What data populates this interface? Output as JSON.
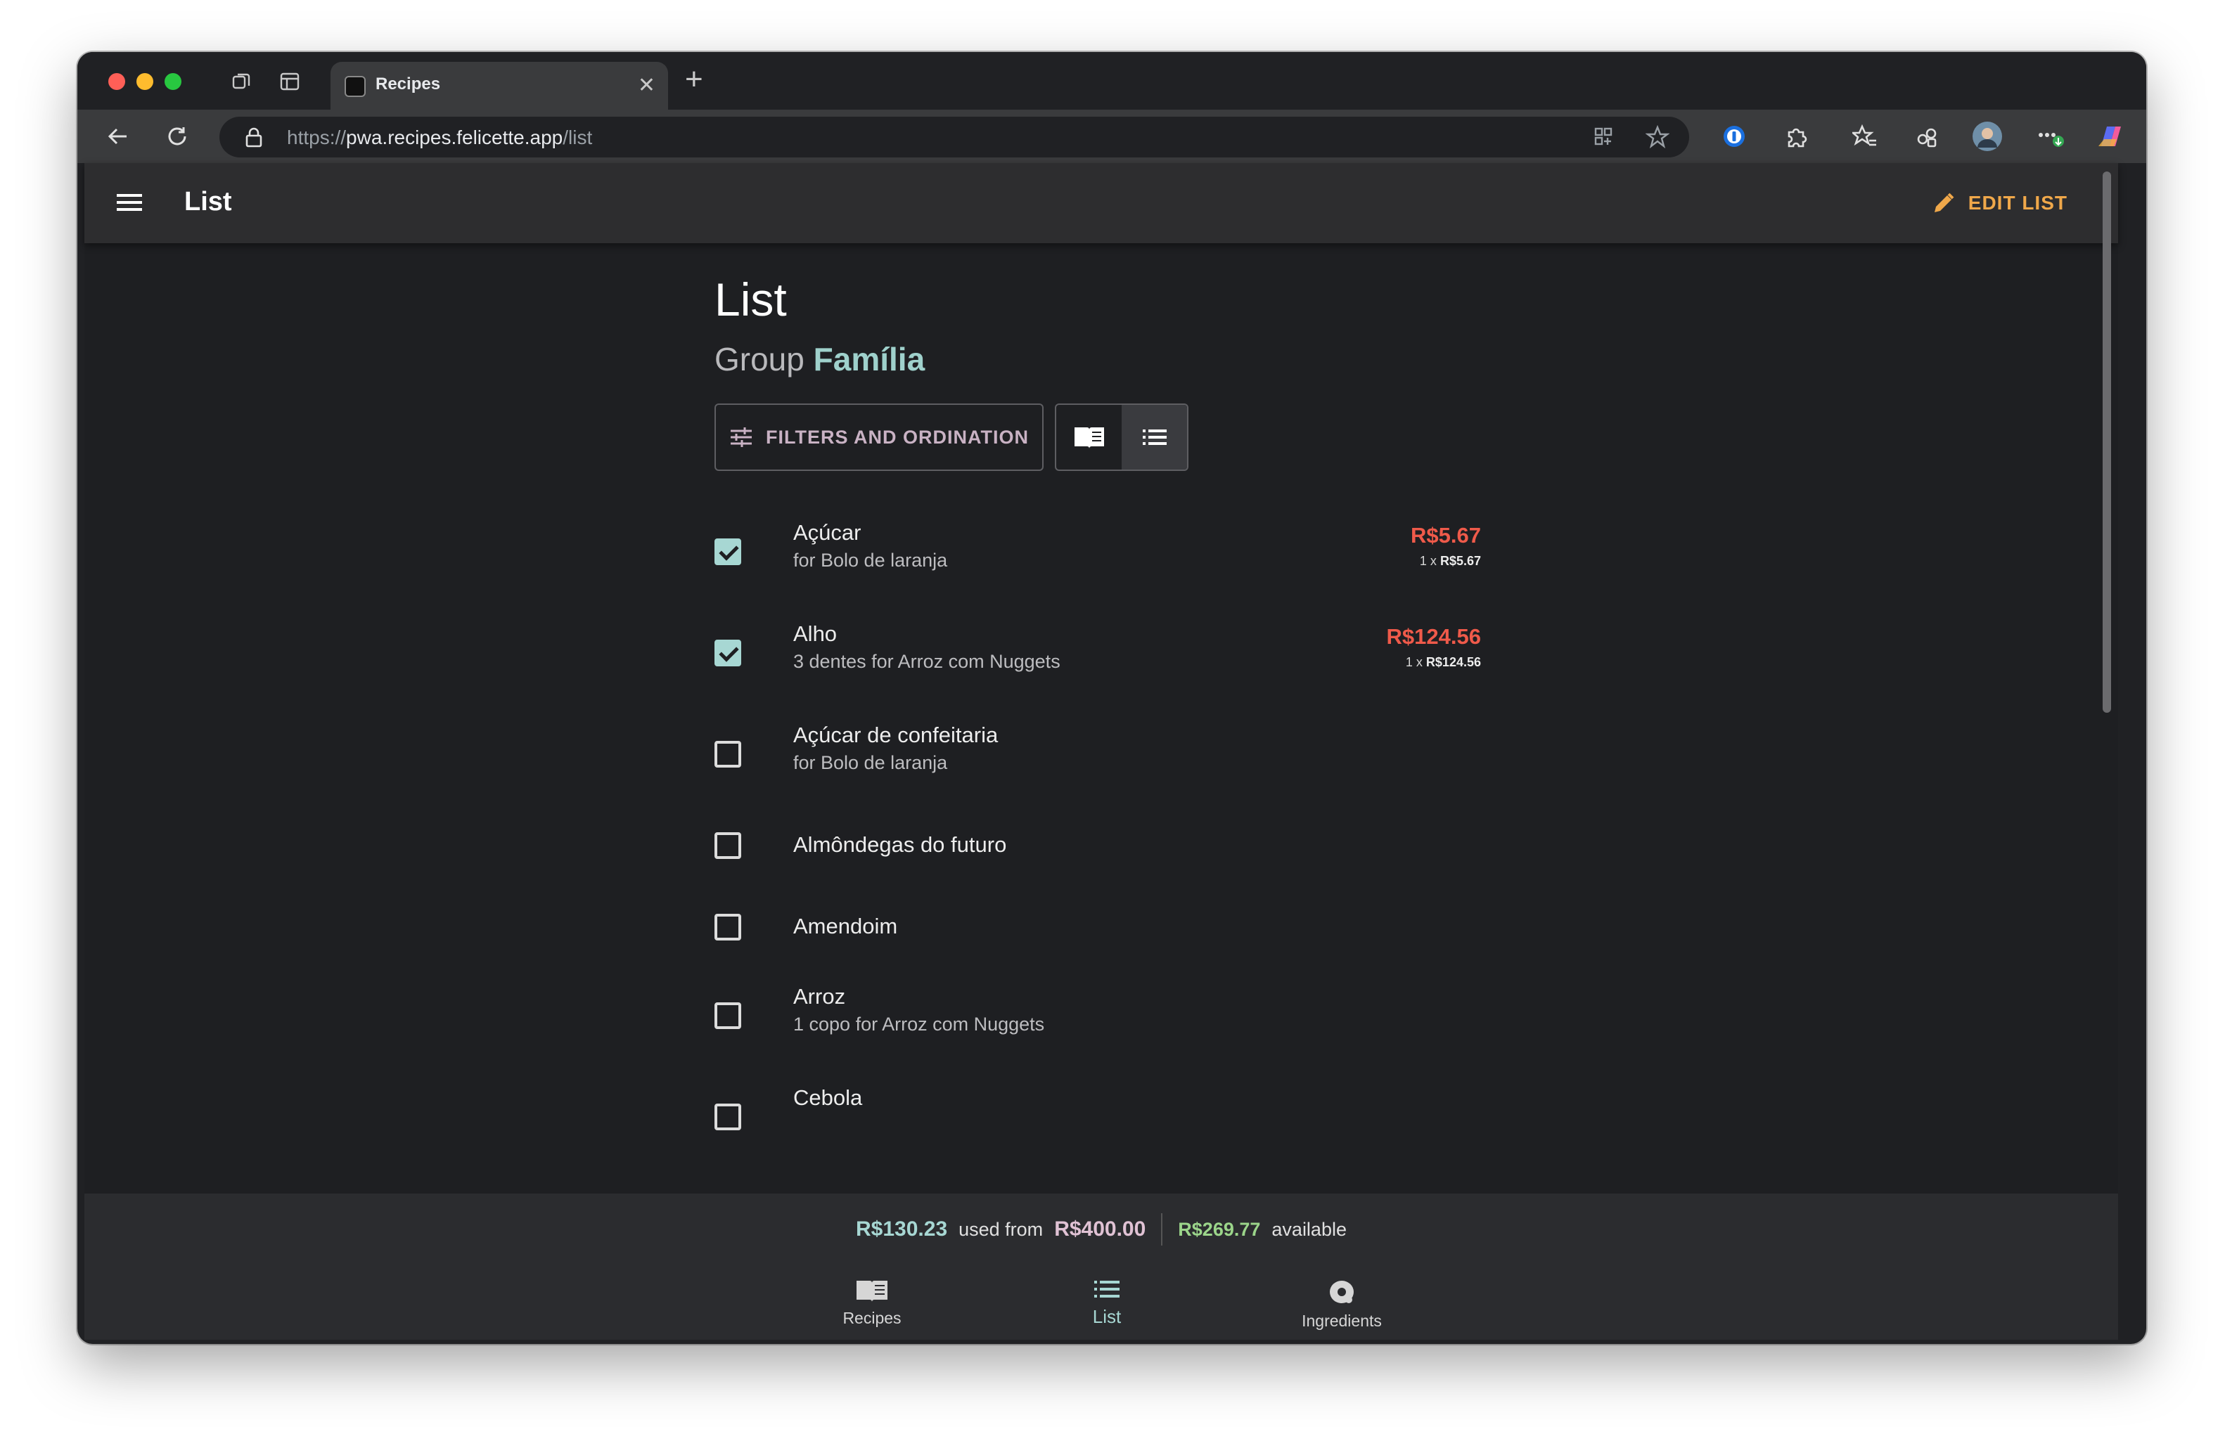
{
  "browser": {
    "tab_title": "Recipes",
    "url_scheme": "https://",
    "url_host": "pwa.recipes.felicette.app",
    "url_path": "/list"
  },
  "appbar": {
    "title": "List",
    "edit_label": "EDIT LIST"
  },
  "header": {
    "title": "List",
    "group_prefix": "Group",
    "group_name": "Família"
  },
  "controls": {
    "filters_label": "FILTERS AND ORDINATION"
  },
  "items": [
    {
      "name": "Açúcar",
      "sub": "for Bolo de laranja",
      "checked": true,
      "price": "R$5.67",
      "qty": "1 x",
      "unit_price": "R$5.67"
    },
    {
      "name": "Alho",
      "sub": "3 dentes for Arroz com Nuggets",
      "checked": true,
      "price": "R$124.56",
      "qty": "1 x",
      "unit_price": "R$124.56"
    },
    {
      "name": "Açúcar de confeitaria",
      "sub": "for Bolo de laranja",
      "checked": false
    },
    {
      "name": "Almôndegas do futuro",
      "checked": false
    },
    {
      "name": "Amendoim",
      "checked": false
    },
    {
      "name": "Arroz",
      "sub": "1 copo for Arroz com Nuggets",
      "checked": false
    },
    {
      "name": "Cebola",
      "checked": false
    }
  ],
  "summary": {
    "used": "R$130.23",
    "used_from_label": "used from",
    "total": "R$400.00",
    "available": "R$269.77",
    "available_label": "available"
  },
  "bottom_nav": {
    "recipes": "Recipes",
    "list": "List",
    "ingredients": "Ingredients"
  },
  "colors": {
    "accent": "#a7d7d3",
    "edit": "#f0a84a",
    "price": "#ef5a4a",
    "available": "#9bd58a"
  }
}
